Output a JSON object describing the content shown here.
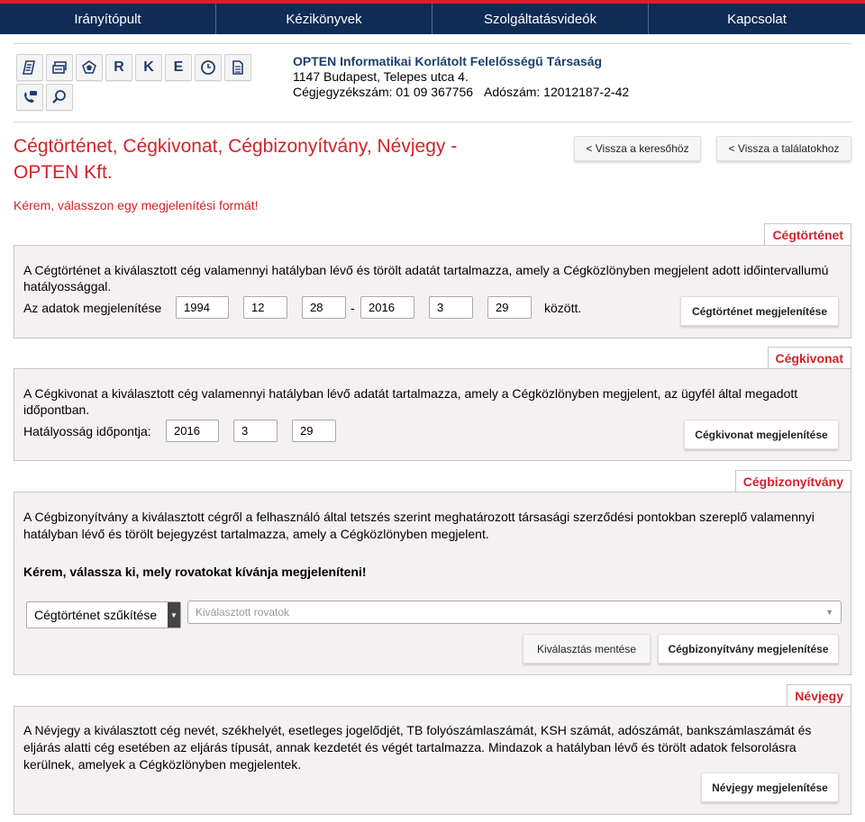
{
  "nav": [
    {
      "label": "Irányítópult"
    },
    {
      "label": "Kézikönyvek"
    },
    {
      "label": "Szolgáltatásvideók"
    },
    {
      "label": "Kapcsolat"
    }
  ],
  "toolbar": {
    "icons": [
      "document-list-icon",
      "id-card-icon",
      "network-web-icon",
      "r-letter-icon",
      "k-letter-icon",
      "e-letter-icon",
      "clock-icon",
      "document-icon",
      "phone-chat-icon",
      "search-icon"
    ],
    "letters": {
      "r": "R",
      "k": "K",
      "e": "E"
    }
  },
  "company": {
    "name": "OPTEN Informatikai Korlátolt Felelősségű Társaság",
    "address": "1147 Budapest, Telepes utca 4.",
    "registry": "Cégjegyzékszám: 01 09 367756",
    "tax": "Adószám: 12012187-2-42"
  },
  "page": {
    "title": "Cégtörténet, Cégkivonat, Cégbizonyítvány, Névjegy - OPTEN Kft.",
    "prompt": "Kérem, válasszon egy megjelenítési formát!",
    "back_search": "< Vissza a keresőhöz",
    "back_results": "< Vissza a találatokhoz"
  },
  "history": {
    "tab": "Cégtörténet",
    "description": "A Cégtörténet a kiválasztott cég valamennyi hatályban lévő és törölt adatát tartalmazza, amely a Cégközlönyben megjelent adott időintervallumú hatályossággal.",
    "label": "Az adatok megjelenítése",
    "from_year": "1994",
    "from_month": "12",
    "from_day": "28",
    "dash": "-",
    "to_year": "2016",
    "to_month": "3",
    "to_day": "29",
    "between": "között.",
    "button": "Cégtörténet megjelenítése"
  },
  "extract": {
    "tab": "Cégkivonat",
    "description": "A Cégkivonat a kiválasztott cég valamennyi hatályban lévő adatát tartalmazza, amely a Cégközlönyben megjelent, az ügyfél által megadott időpontban.",
    "label": "Hatályosság időpontja:",
    "year": "2016",
    "month": "3",
    "day": "29",
    "button": "Cégkivonat megjelenítése"
  },
  "certificate": {
    "tab": "Cégbizonyítvány",
    "description": "A Cégbizonyítvány a kiválasztott cégről a felhasználó által tetszés szerint meghatározott társasági szerződési pontokban szereplő valamennyi hatályban lévő és törölt bejegyzést tartalmazza, amely a Cégközlönyben megjelent.",
    "instruction": "Kérem, válassza ki, mely rovatokat kívánja megjeleníteni!",
    "select_value": "Cégtörténet szűkítése",
    "multi_placeholder": "Kiválasztott rovatok",
    "save_button": "Kiválasztás mentése",
    "button": "Cégbizonyítvány megjelenítése"
  },
  "card": {
    "tab": "Névjegy",
    "description": "A Névjegy a kiválasztott cég nevét, székhelyét, esetleges jogelődjét, TB folyószámlaszámát, KSH számát, adószámát, bankszámlaszámát és eljárás alatti cég esetében az eljárás típusát, annak kezdetét és végét tartalmazza. Mindazok a hatályban lévő és törölt adatok felsorolásra kerülnek, amelyek a Cégközlönyben megjelentek.",
    "button": "Névjegy megjelenítése"
  }
}
